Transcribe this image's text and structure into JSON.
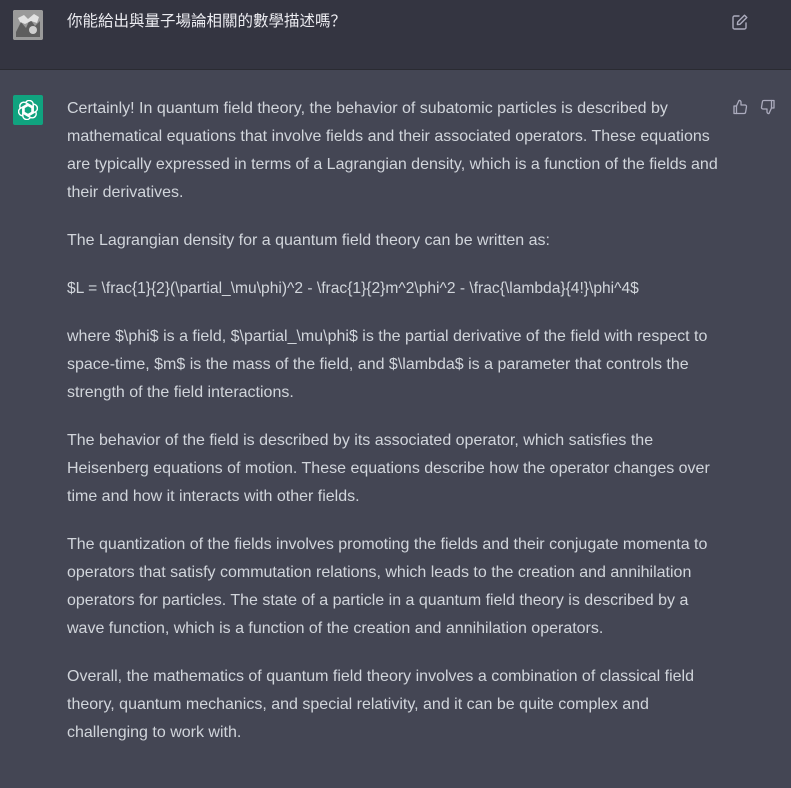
{
  "user_message": {
    "avatar": "user-avatar-image",
    "text": "你能給出與量子場論相關的數學描述嗎？",
    "edit_icon": "edit-icon"
  },
  "assistant_message": {
    "avatar": "openai-logo-icon",
    "paragraphs": [
      "Certainly! In quantum field theory, the behavior of subatomic particles is described by mathematical equations that involve fields and their associated operators. These equations are typically expressed in terms of a Lagrangian density, which is a function of the fields and their derivatives.",
      "The Lagrangian density for a quantum field theory can be written as:",
      "$L = \\frac{1}{2}(\\partial_\\mu\\phi)^2 - \\frac{1}{2}m^2\\phi^2 - \\frac{\\lambda}{4!}\\phi^4$",
      "where $\\phi$ is a field, $\\partial_\\mu\\phi$ is the partial derivative of the field with respect to space-time, $m$ is the mass of the field, and $\\lambda$ is a parameter that controls the strength of the field interactions.",
      "The behavior of the field is described by its associated operator, which satisfies the Heisenberg equations of motion. These equations describe how the operator changes over time and how it interacts with other fields.",
      "The quantization of the fields involves promoting the fields and their conjugate momenta to operators that satisfy commutation relations, which leads to the creation and annihilation operators for particles. The state of a particle in a quantum field theory is described by a wave function, which is a function of the creation and annihilation operators.",
      "Overall, the mathematics of quantum field theory involves a combination of classical field theory, quantum mechanics, and special relativity, and it can be quite complex and challenging to work with."
    ],
    "feedback_icons": [
      "thumbs-up-icon",
      "thumbs-down-icon"
    ]
  },
  "colors": {
    "user_row_bg": "#343541",
    "assistant_row_bg": "#444654",
    "text": "#d1d5db",
    "bot_avatar_bg": "#10a37f",
    "icon": "#acacbe"
  }
}
